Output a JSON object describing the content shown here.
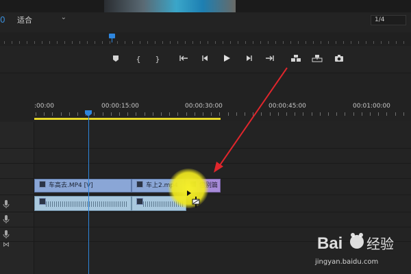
{
  "monitor": {
    "timecode": "0",
    "fit_label": "适合",
    "resolution": "1/4"
  },
  "controls": [
    {
      "name": "add-marker-button",
      "glyph": "⬟"
    },
    {
      "name": "mark-in-button",
      "glyph": "{"
    },
    {
      "name": "mark-out-button",
      "glyph": "}"
    },
    {
      "name": "go-to-in-button",
      "glyph": "{←"
    },
    {
      "name": "step-back-button",
      "glyph": "◂|"
    },
    {
      "name": "play-button",
      "glyph": "▶"
    },
    {
      "name": "step-forward-button",
      "glyph": "|▸"
    },
    {
      "name": "go-to-out-button",
      "glyph": "→}"
    },
    {
      "name": "insert-button",
      "glyph": "⊞"
    },
    {
      "name": "overwrite-button",
      "glyph": "⊟"
    },
    {
      "name": "export-frame-button",
      "glyph": "📷"
    }
  ],
  "ruler": {
    "labels": [
      ":00:00",
      "00:00:15:00",
      "00:00:30:00",
      "00:00:45:00",
      "00:01:00:00"
    ]
  },
  "clips": {
    "video": [
      {
        "label": "车高去.MP4 [V]"
      },
      {
        "label": "车上2.mp4"
      },
      {
        "label": "告别篇"
      }
    ]
  },
  "watermark": {
    "brand": "Bai",
    "sub": "经验",
    "url": "jingyan.baidu.com"
  },
  "colors": {
    "playhead": "#2e86de",
    "work_area": "#e5d62b",
    "video_clip": "#8aa6d6",
    "audio_clip": "#a9c8de",
    "highlight": "#f4ef2a",
    "arrow": "#e0262c"
  }
}
